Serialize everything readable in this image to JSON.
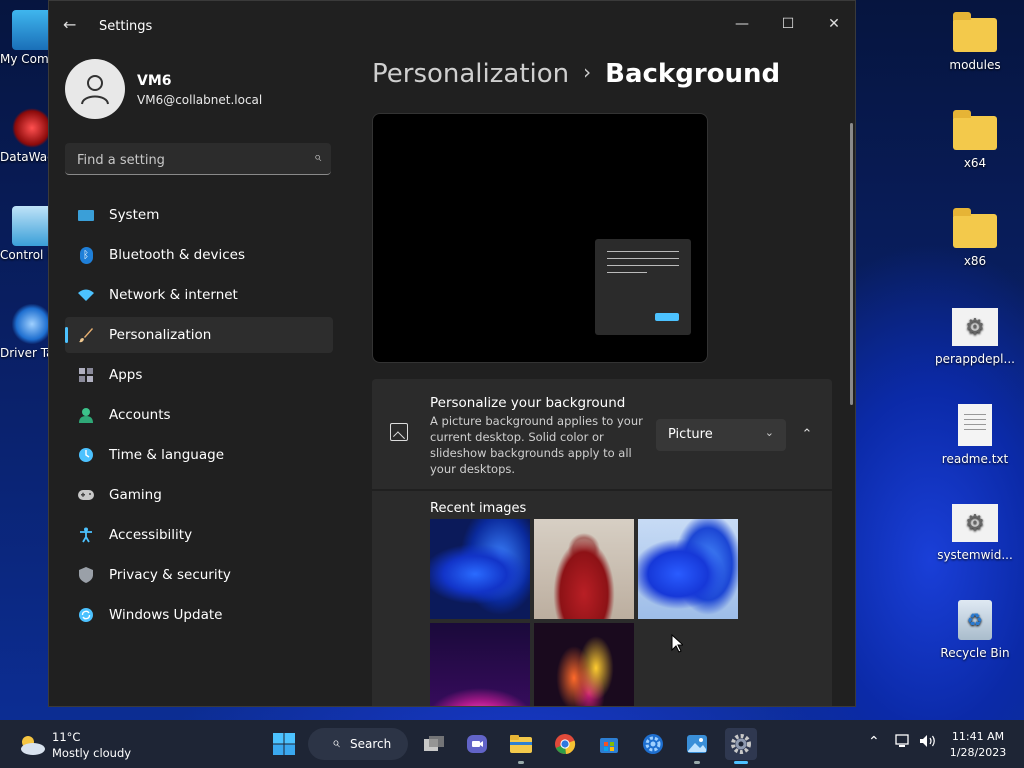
{
  "window": {
    "title": "Settings",
    "back_glyph": "←",
    "minimize_glyph": "—",
    "maximize_glyph": "☐",
    "close_glyph": "✕"
  },
  "user": {
    "name": "VM6",
    "email": "VM6@collabnet.local"
  },
  "search": {
    "placeholder": "Find a setting",
    "icon": "search-icon"
  },
  "nav": {
    "items": [
      {
        "label": "System",
        "icon": "monitor-icon",
        "color": "#3a9fd8"
      },
      {
        "label": "Bluetooth & devices",
        "icon": "bluetooth-icon",
        "color": "#3a9fd8"
      },
      {
        "label": "Network & internet",
        "icon": "wifi-icon",
        "color": "#4cc2ff"
      },
      {
        "label": "Personalization",
        "icon": "brush-icon",
        "color": "#e8b070",
        "active": true
      },
      {
        "label": "Apps",
        "icon": "apps-icon",
        "color": "#b0b0c0"
      },
      {
        "label": "Accounts",
        "icon": "person-icon",
        "color": "#3cc28a"
      },
      {
        "label": "Time & language",
        "icon": "globe-clock-icon",
        "color": "#4cc2ff"
      },
      {
        "label": "Gaming",
        "icon": "gamepad-icon",
        "color": "#c8c8c8"
      },
      {
        "label": "Accessibility",
        "icon": "accessibility-icon",
        "color": "#4cc2ff"
      },
      {
        "label": "Privacy & security",
        "icon": "shield-icon",
        "color": "#9aa0a8"
      },
      {
        "label": "Windows Update",
        "icon": "refresh-icon",
        "color": "#4cc2ff"
      }
    ]
  },
  "breadcrumb": {
    "parent": "Personalization",
    "separator": "›",
    "current": "Background"
  },
  "personalize": {
    "title": "Personalize your background",
    "description": "A picture background applies to your current desktop. Solid color or slideshow backgrounds apply to all your desktops.",
    "selected": "Picture",
    "chevron": "⌄",
    "collapse_glyph": "⌃"
  },
  "recent": {
    "title": "Recent images"
  },
  "desktop": {
    "right_icons": [
      "modules",
      "x64",
      "x86",
      "perappdepl...",
      "readme.txt",
      "systemwid...",
      "Recycle Bin"
    ],
    "left_icons": [
      "My Com",
      "DataWag",
      "Control P",
      "Driver Ta"
    ]
  },
  "taskbar": {
    "weather_temp": "11°C",
    "weather_cond": "Mostly cloudy",
    "search_label": "Search",
    "time": "11:41 AM",
    "date": "1/28/2023"
  },
  "colors": {
    "accent": "#4cc2ff",
    "window_bg": "#202020",
    "card_bg": "#2b2b2b"
  }
}
